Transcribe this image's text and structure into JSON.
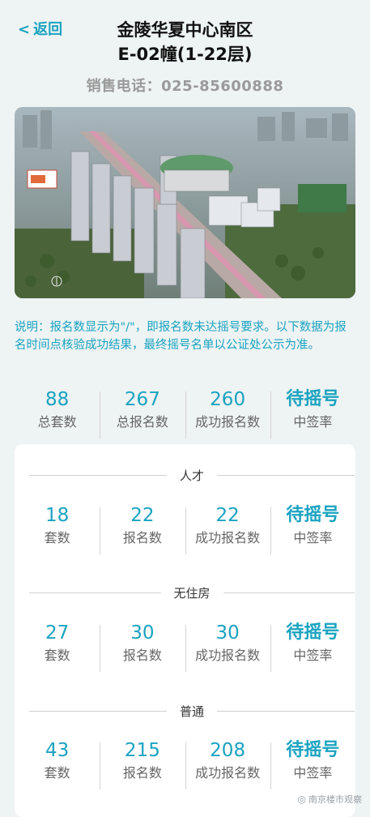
{
  "header": {
    "back_label": "返回",
    "title_line1": "金陵华夏中心南区",
    "title_line2": "E-02幢(1-22层)",
    "phone": "销售电话：025-85600888"
  },
  "note": "说明：报名数显示为\"/\"，即报名数未达摇号要求。以下数据为报名时间点核验成功结果，最终摇号名单以公证处公示为准。",
  "summary": {
    "total_units": "88",
    "total_units_label": "总套数",
    "total_reg": "267",
    "total_reg_label": "总报名数",
    "success_reg": "260",
    "success_reg_label": "成功报名数",
    "pending": "待摇号",
    "rate_label": "中签率"
  },
  "sections": [
    {
      "title": "人才",
      "units": "18",
      "units_label": "套数",
      "reg": "22",
      "reg_label": "报名数",
      "success": "22",
      "success_label": "成功报名数",
      "pending": "待摇号",
      "rate_label": "中签率"
    },
    {
      "title": "无住房",
      "units": "27",
      "units_label": "套数",
      "reg": "30",
      "reg_label": "报名数",
      "success": "30",
      "success_label": "成功报名数",
      "pending": "待摇号",
      "rate_label": "中签率"
    },
    {
      "title": "普通",
      "units": "43",
      "units_label": "套数",
      "reg": "215",
      "reg_label": "报名数",
      "success": "208",
      "success_label": "成功报名数",
      "pending": "待摇号",
      "rate_label": "中签率"
    }
  ],
  "watermark": "南京楼市观察",
  "colors": {
    "accent": "#1aa3c0",
    "background": "#eef3f3",
    "card": "#ffffff"
  }
}
